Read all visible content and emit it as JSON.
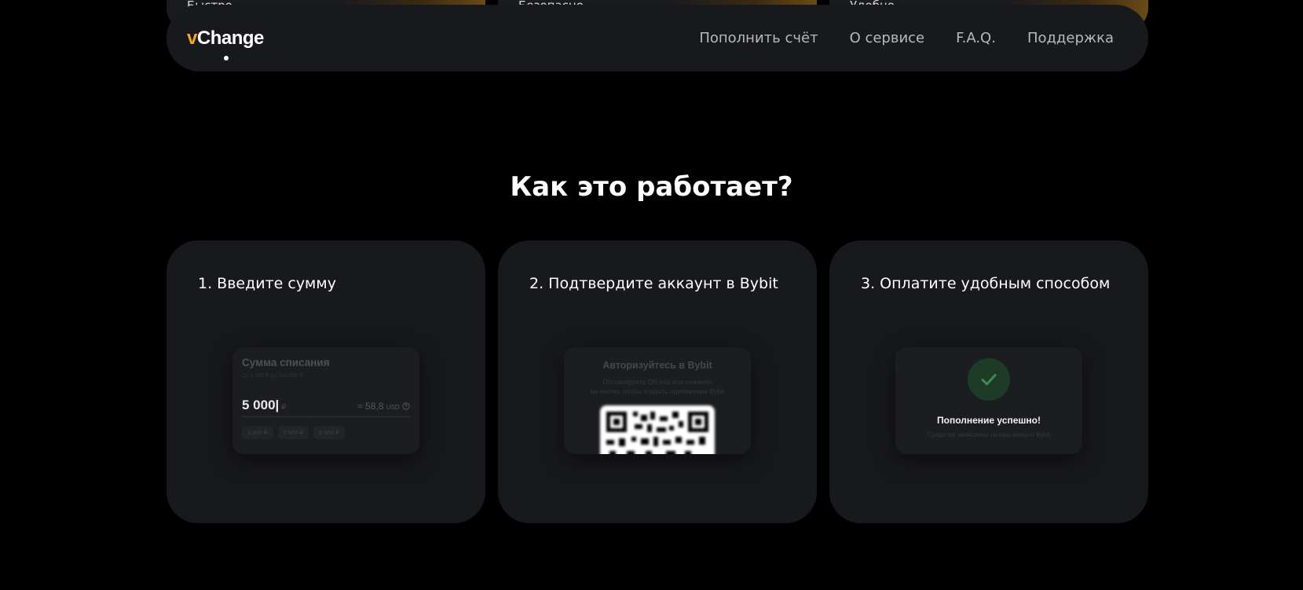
{
  "peek_cards": [
    "Быстро",
    "Безопасно",
    "Удобно"
  ],
  "header": {
    "logo_v": "v",
    "logo_rest": "Change",
    "nav": [
      "Пополнить счёт",
      "О сервисе",
      "F.A.Q.",
      "Поддержка"
    ]
  },
  "section_title": "Как это работает?",
  "steps": [
    {
      "title": "1. Введите сумму",
      "mock": {
        "label": "Сумма списания",
        "hint": "От 1 000 ₽ до 100 000 ₽",
        "amount": "5 000|",
        "currency": "₽",
        "usd_value": "≈ 58,8",
        "usd_unit": "USD",
        "chips": [
          "1 000 ₽",
          "2 500 ₽",
          "5 000 ₽"
        ]
      }
    },
    {
      "title": "2. Подтвердите аккаунт в Bybit",
      "mock": {
        "label": "Авторизуйтесь в Bybit",
        "hint_line1": "Отсканируйте QR-код или нажмите",
        "hint_line2": "на кнопку, чтобы открыть приложение Bybit"
      }
    },
    {
      "title": "3. Оплатите удобным способом",
      "mock": {
        "label": "Пополнение успешно!",
        "hint": "Средства зачислены на ваш аккаунт Bybit"
      }
    }
  ],
  "icons": {
    "success": "check-icon",
    "help": "question-circle-icon",
    "qr": "qr-code-icon"
  },
  "colors": {
    "accent": "#f5a623",
    "card_bg": "#18191d",
    "page_bg": "#000000",
    "success": "#4caf50"
  }
}
